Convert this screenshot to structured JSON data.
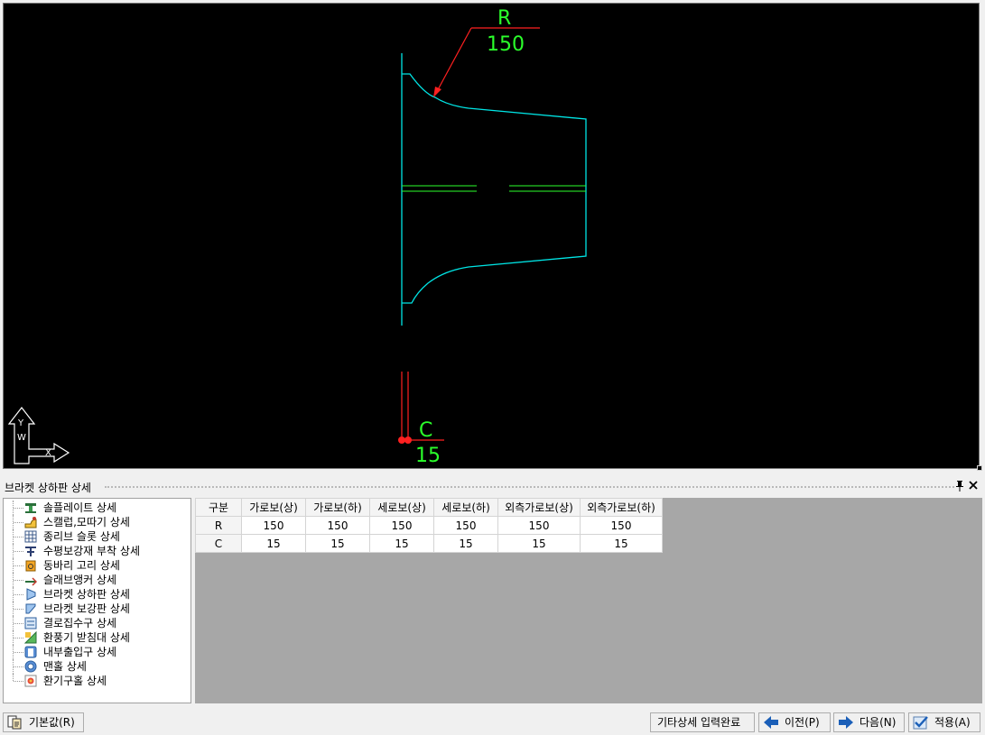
{
  "viewport": {
    "labels": {
      "r_letter": "R",
      "r_value": "150",
      "c_letter": "C",
      "c_value": "15",
      "ucs_y": "Y",
      "ucs_w": "W",
      "ucs_x": "X"
    },
    "colors": {
      "background": "#000000",
      "outline": "#00e5e5",
      "dimension_text": "#2bff2b",
      "leader": "#ff2020",
      "ucs": "#ffffff"
    }
  },
  "panel": {
    "title": "브라켓 상하판 상세",
    "pin_icon": "pin-icon",
    "close_icon": "close-icon"
  },
  "tree": {
    "items": [
      {
        "label": "솔플레이트 상세",
        "icon": "sole-plate-icon"
      },
      {
        "label": "스캘럽,모따기 상세",
        "icon": "scallop-icon"
      },
      {
        "label": "종리브 슬롯 상세",
        "icon": "rib-slot-icon"
      },
      {
        "label": "수평보강재 부착 상세",
        "icon": "stiffener-icon"
      },
      {
        "label": "동바리 고리 상세",
        "icon": "hook-icon"
      },
      {
        "label": "슬래브앵커 상세",
        "icon": "anchor-icon"
      },
      {
        "label": "브라켓 상하판 상세",
        "icon": "bracket-plate-icon"
      },
      {
        "label": "브라켓 보강판 상세",
        "icon": "bracket-stiffener-icon"
      },
      {
        "label": "결로집수구 상세",
        "icon": "drain-icon"
      },
      {
        "label": "환풍기 받침대 상세",
        "icon": "fan-stand-icon"
      },
      {
        "label": "내부출입구 상세",
        "icon": "door-icon"
      },
      {
        "label": "맨홀 상세",
        "icon": "manhole-icon"
      },
      {
        "label": "환기구홀 상세",
        "icon": "vent-hole-icon"
      }
    ]
  },
  "table": {
    "headers": [
      "구분",
      "가로보(상)",
      "가로보(하)",
      "세로보(상)",
      "세로보(하)",
      "외측가로보(상)",
      "외측가로보(하)"
    ],
    "rows": [
      [
        "R",
        "150",
        "150",
        "150",
        "150",
        "150",
        "150"
      ],
      [
        "C",
        "15",
        "15",
        "15",
        "15",
        "15",
        "15"
      ]
    ]
  },
  "buttons": {
    "defaults": "기본값(R)",
    "complete": "기타상세 입력완료",
    "prev": "이전(P)",
    "next": "다음(N)",
    "apply": "적용(A)"
  }
}
